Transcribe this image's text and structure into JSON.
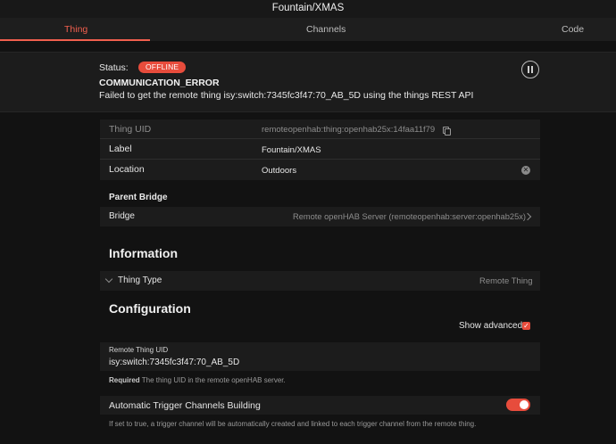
{
  "window": {
    "title": "Fountain/XMAS"
  },
  "tabs": [
    {
      "label": "Thing",
      "active": true
    },
    {
      "label": "Channels",
      "active": false
    },
    {
      "label": "Code",
      "active": false
    }
  ],
  "status": {
    "label": "Status:",
    "badge": "OFFLINE",
    "detail_code": "COMMUNICATION_ERROR",
    "detail_message": "Failed to get the remote thing isy:switch:7345fc3f47:70_AB_5D using the things REST API"
  },
  "thing": {
    "uid_label": "Thing UID",
    "uid_value": "remoteopenhab:thing:openhab25x:14faa11f79",
    "label_label": "Label",
    "label_value": "Fountain/XMAS",
    "location_label": "Location",
    "location_value": "Outdoors"
  },
  "bridge": {
    "section_title": "Parent Bridge",
    "label": "Bridge",
    "value": "Remote openHAB Server (remoteopenhab:server:openhab25x)"
  },
  "information": {
    "title": "Information",
    "thing_type_label": "Thing Type",
    "thing_type_value": "Remote Thing"
  },
  "configuration": {
    "title": "Configuration",
    "show_advanced_label": "Show advanced",
    "show_advanced_checked": true,
    "remote_uid_label": "Remote Thing UID",
    "remote_uid_value": "isy:switch:7345fc3f47:70_AB_5D",
    "required_label": "Required",
    "required_hint": "The thing UID in the remote openHAB server.",
    "trigger_label": "Automatic Trigger Channels Building",
    "trigger_enabled": true,
    "trigger_hint": "If set to true, a trigger channel will be automatically created and linked to each trigger channel from the remote thing."
  },
  "colors": {
    "accent": "#e74c3c",
    "background": "#121212",
    "card": "#1c1c1c"
  },
  "icons": [
    "pause-icon",
    "copy-icon",
    "clear-icon",
    "chevron-right-icon",
    "chevron-down-icon",
    "checkbox-icon"
  ]
}
